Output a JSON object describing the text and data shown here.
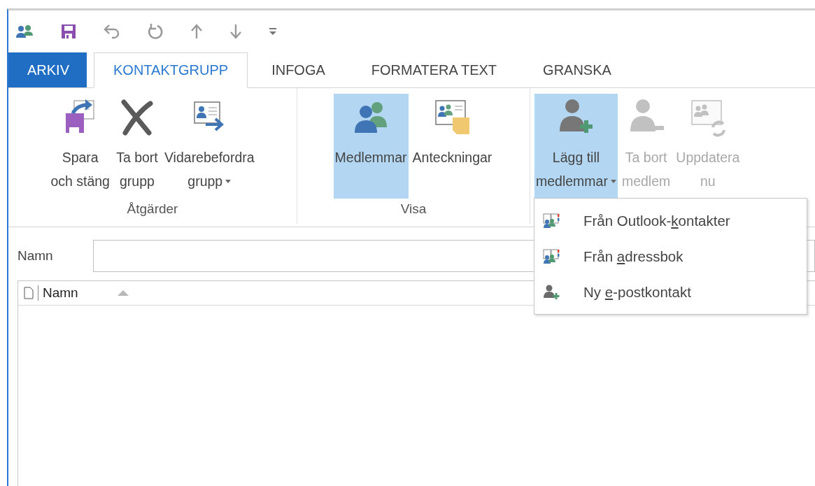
{
  "tabs": [
    {
      "label": "ARKIV",
      "kind": "file",
      "selected": false
    },
    {
      "label": "KONTAKTGRUPP",
      "kind": "tab",
      "selected": true
    },
    {
      "label": "INFOGA",
      "kind": "tab",
      "selected": false
    },
    {
      "label": "FORMATERA TEXT",
      "kind": "tab",
      "selected": false
    },
    {
      "label": "GRANSKA",
      "kind": "tab",
      "selected": false
    }
  ],
  "ribbon_groups": [
    {
      "label": "Åtgärder",
      "buttons": [
        {
          "kind": "save-close",
          "label_lines": [
            "Spara",
            "och stäng"
          ],
          "selected": false,
          "disabled": false,
          "dropdown": false
        },
        {
          "kind": "delete",
          "label_lines": [
            "Ta bort",
            "grupp"
          ],
          "selected": false,
          "disabled": false,
          "dropdown": false
        },
        {
          "kind": "forward",
          "label_lines": [
            "Vidarebefordra",
            "grupp"
          ],
          "selected": false,
          "disabled": false,
          "dropdown": true
        }
      ]
    },
    {
      "label": "Visa",
      "buttons": [
        {
          "kind": "members",
          "label_lines": [
            "Medlemmar"
          ],
          "selected": true,
          "disabled": false,
          "dropdown": false
        },
        {
          "kind": "notes",
          "label_lines": [
            "Anteckningar"
          ],
          "selected": false,
          "disabled": false,
          "dropdown": false
        }
      ]
    },
    {
      "buttons": [
        {
          "kind": "add-member",
          "label_lines": [
            "Lägg till",
            "medlemmar"
          ],
          "selected": true,
          "disabled": false,
          "dropdown": true
        },
        {
          "kind": "remove-member",
          "label_lines": [
            "Ta bort",
            "medlem"
          ],
          "selected": false,
          "disabled": true,
          "dropdown": false
        },
        {
          "kind": "refresh",
          "label_lines": [
            "Uppdatera",
            "nu"
          ],
          "selected": false,
          "disabled": true,
          "dropdown": false
        }
      ]
    }
  ],
  "name_field": {
    "label": "Namn"
  },
  "member_list": {
    "columns": [
      {
        "label": "Namn",
        "sorted_ascending": true
      }
    ]
  },
  "dropdown_menu": {
    "items": [
      {
        "kind": "address-book",
        "label_parts": [
          "Från Outlook-",
          "k",
          "ontakter"
        ]
      },
      {
        "kind": "address-book",
        "label_parts": [
          "Från ",
          "a",
          "dressbok"
        ]
      },
      {
        "kind": "new-contact",
        "label_parts": [
          "Ny ",
          "e",
          "-postkontakt"
        ]
      }
    ]
  }
}
